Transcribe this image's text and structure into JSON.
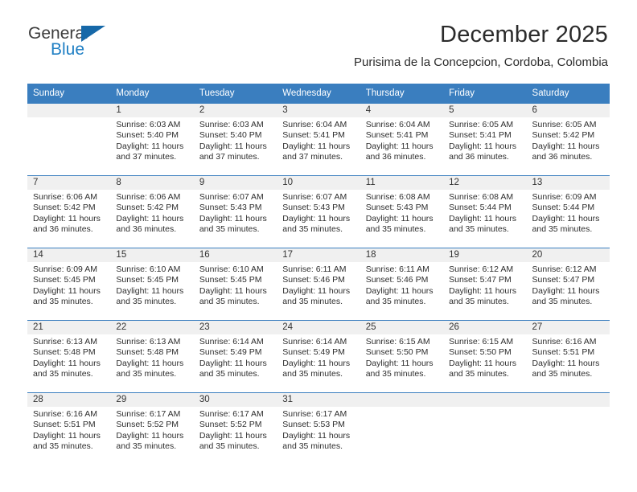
{
  "brand": {
    "name_top": "General",
    "name_bottom": "Blue",
    "triangle_color": "#1668a8",
    "blue_text_color": "#1f7fc4"
  },
  "header": {
    "title": "December 2025",
    "subtitle": "Purisima de la Concepcion, Cordoba, Colombia"
  },
  "theme": {
    "header_row_bg": "#3a7ebf",
    "daynum_strip_bg": "#f0f0f0",
    "grid_line": "#3a7ebf"
  },
  "weekday_headers": [
    "Sunday",
    "Monday",
    "Tuesday",
    "Wednesday",
    "Thursday",
    "Friday",
    "Saturday"
  ],
  "weeks": [
    [
      {
        "day": "",
        "sunrise": "",
        "sunset": "",
        "daylight_line1": "",
        "daylight_line2": "",
        "empty": true
      },
      {
        "day": "1",
        "sunrise": "Sunrise: 6:03 AM",
        "sunset": "Sunset: 5:40 PM",
        "daylight_line1": "Daylight: 11 hours",
        "daylight_line2": "and 37 minutes."
      },
      {
        "day": "2",
        "sunrise": "Sunrise: 6:03 AM",
        "sunset": "Sunset: 5:40 PM",
        "daylight_line1": "Daylight: 11 hours",
        "daylight_line2": "and 37 minutes."
      },
      {
        "day": "3",
        "sunrise": "Sunrise: 6:04 AM",
        "sunset": "Sunset: 5:41 PM",
        "daylight_line1": "Daylight: 11 hours",
        "daylight_line2": "and 37 minutes."
      },
      {
        "day": "4",
        "sunrise": "Sunrise: 6:04 AM",
        "sunset": "Sunset: 5:41 PM",
        "daylight_line1": "Daylight: 11 hours",
        "daylight_line2": "and 36 minutes."
      },
      {
        "day": "5",
        "sunrise": "Sunrise: 6:05 AM",
        "sunset": "Sunset: 5:41 PM",
        "daylight_line1": "Daylight: 11 hours",
        "daylight_line2": "and 36 minutes."
      },
      {
        "day": "6",
        "sunrise": "Sunrise: 6:05 AM",
        "sunset": "Sunset: 5:42 PM",
        "daylight_line1": "Daylight: 11 hours",
        "daylight_line2": "and 36 minutes."
      }
    ],
    [
      {
        "day": "7",
        "sunrise": "Sunrise: 6:06 AM",
        "sunset": "Sunset: 5:42 PM",
        "daylight_line1": "Daylight: 11 hours",
        "daylight_line2": "and 36 minutes."
      },
      {
        "day": "8",
        "sunrise": "Sunrise: 6:06 AM",
        "sunset": "Sunset: 5:42 PM",
        "daylight_line1": "Daylight: 11 hours",
        "daylight_line2": "and 36 minutes."
      },
      {
        "day": "9",
        "sunrise": "Sunrise: 6:07 AM",
        "sunset": "Sunset: 5:43 PM",
        "daylight_line1": "Daylight: 11 hours",
        "daylight_line2": "and 35 minutes."
      },
      {
        "day": "10",
        "sunrise": "Sunrise: 6:07 AM",
        "sunset": "Sunset: 5:43 PM",
        "daylight_line1": "Daylight: 11 hours",
        "daylight_line2": "and 35 minutes."
      },
      {
        "day": "11",
        "sunrise": "Sunrise: 6:08 AM",
        "sunset": "Sunset: 5:43 PM",
        "daylight_line1": "Daylight: 11 hours",
        "daylight_line2": "and 35 minutes."
      },
      {
        "day": "12",
        "sunrise": "Sunrise: 6:08 AM",
        "sunset": "Sunset: 5:44 PM",
        "daylight_line1": "Daylight: 11 hours",
        "daylight_line2": "and 35 minutes."
      },
      {
        "day": "13",
        "sunrise": "Sunrise: 6:09 AM",
        "sunset": "Sunset: 5:44 PM",
        "daylight_line1": "Daylight: 11 hours",
        "daylight_line2": "and 35 minutes."
      }
    ],
    [
      {
        "day": "14",
        "sunrise": "Sunrise: 6:09 AM",
        "sunset": "Sunset: 5:45 PM",
        "daylight_line1": "Daylight: 11 hours",
        "daylight_line2": "and 35 minutes."
      },
      {
        "day": "15",
        "sunrise": "Sunrise: 6:10 AM",
        "sunset": "Sunset: 5:45 PM",
        "daylight_line1": "Daylight: 11 hours",
        "daylight_line2": "and 35 minutes."
      },
      {
        "day": "16",
        "sunrise": "Sunrise: 6:10 AM",
        "sunset": "Sunset: 5:45 PM",
        "daylight_line1": "Daylight: 11 hours",
        "daylight_line2": "and 35 minutes."
      },
      {
        "day": "17",
        "sunrise": "Sunrise: 6:11 AM",
        "sunset": "Sunset: 5:46 PM",
        "daylight_line1": "Daylight: 11 hours",
        "daylight_line2": "and 35 minutes."
      },
      {
        "day": "18",
        "sunrise": "Sunrise: 6:11 AM",
        "sunset": "Sunset: 5:46 PM",
        "daylight_line1": "Daylight: 11 hours",
        "daylight_line2": "and 35 minutes."
      },
      {
        "day": "19",
        "sunrise": "Sunrise: 6:12 AM",
        "sunset": "Sunset: 5:47 PM",
        "daylight_line1": "Daylight: 11 hours",
        "daylight_line2": "and 35 minutes."
      },
      {
        "day": "20",
        "sunrise": "Sunrise: 6:12 AM",
        "sunset": "Sunset: 5:47 PM",
        "daylight_line1": "Daylight: 11 hours",
        "daylight_line2": "and 35 minutes."
      }
    ],
    [
      {
        "day": "21",
        "sunrise": "Sunrise: 6:13 AM",
        "sunset": "Sunset: 5:48 PM",
        "daylight_line1": "Daylight: 11 hours",
        "daylight_line2": "and 35 minutes."
      },
      {
        "day": "22",
        "sunrise": "Sunrise: 6:13 AM",
        "sunset": "Sunset: 5:48 PM",
        "daylight_line1": "Daylight: 11 hours",
        "daylight_line2": "and 35 minutes."
      },
      {
        "day": "23",
        "sunrise": "Sunrise: 6:14 AM",
        "sunset": "Sunset: 5:49 PM",
        "daylight_line1": "Daylight: 11 hours",
        "daylight_line2": "and 35 minutes."
      },
      {
        "day": "24",
        "sunrise": "Sunrise: 6:14 AM",
        "sunset": "Sunset: 5:49 PM",
        "daylight_line1": "Daylight: 11 hours",
        "daylight_line2": "and 35 minutes."
      },
      {
        "day": "25",
        "sunrise": "Sunrise: 6:15 AM",
        "sunset": "Sunset: 5:50 PM",
        "daylight_line1": "Daylight: 11 hours",
        "daylight_line2": "and 35 minutes."
      },
      {
        "day": "26",
        "sunrise": "Sunrise: 6:15 AM",
        "sunset": "Sunset: 5:50 PM",
        "daylight_line1": "Daylight: 11 hours",
        "daylight_line2": "and 35 minutes."
      },
      {
        "day": "27",
        "sunrise": "Sunrise: 6:16 AM",
        "sunset": "Sunset: 5:51 PM",
        "daylight_line1": "Daylight: 11 hours",
        "daylight_line2": "and 35 minutes."
      }
    ],
    [
      {
        "day": "28",
        "sunrise": "Sunrise: 6:16 AM",
        "sunset": "Sunset: 5:51 PM",
        "daylight_line1": "Daylight: 11 hours",
        "daylight_line2": "and 35 minutes."
      },
      {
        "day": "29",
        "sunrise": "Sunrise: 6:17 AM",
        "sunset": "Sunset: 5:52 PM",
        "daylight_line1": "Daylight: 11 hours",
        "daylight_line2": "and 35 minutes."
      },
      {
        "day": "30",
        "sunrise": "Sunrise: 6:17 AM",
        "sunset": "Sunset: 5:52 PM",
        "daylight_line1": "Daylight: 11 hours",
        "daylight_line2": "and 35 minutes."
      },
      {
        "day": "31",
        "sunrise": "Sunrise: 6:17 AM",
        "sunset": "Sunset: 5:53 PM",
        "daylight_line1": "Daylight: 11 hours",
        "daylight_line2": "and 35 minutes."
      },
      {
        "day": "",
        "sunrise": "",
        "sunset": "",
        "daylight_line1": "",
        "daylight_line2": "",
        "empty": true
      },
      {
        "day": "",
        "sunrise": "",
        "sunset": "",
        "daylight_line1": "",
        "daylight_line2": "",
        "empty": true
      },
      {
        "day": "",
        "sunrise": "",
        "sunset": "",
        "daylight_line1": "",
        "daylight_line2": "",
        "empty": true
      }
    ]
  ]
}
